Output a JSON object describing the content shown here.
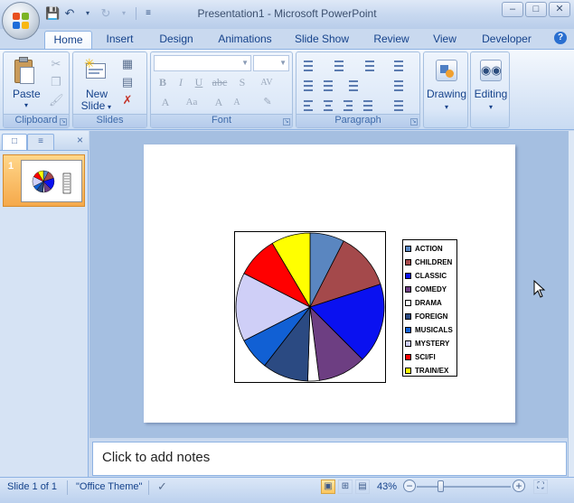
{
  "window": {
    "title": "Presentation1 - Microsoft PowerPoint",
    "controls": {
      "minimize": "–",
      "maximize": "□",
      "close": "✕"
    }
  },
  "qat": {
    "save_icon": "save-icon",
    "undo_icon": "undo-icon",
    "redo_icon": "redo-icon",
    "customize_icon": "customize-qat-icon"
  },
  "tabs": [
    {
      "label": "Home",
      "active": true
    },
    {
      "label": "Insert"
    },
    {
      "label": "Design"
    },
    {
      "label": "Animations"
    },
    {
      "label": "Slide Show"
    },
    {
      "label": "Review"
    },
    {
      "label": "View"
    },
    {
      "label": "Developer"
    }
  ],
  "ribbon": {
    "clipboard": {
      "label": "Clipboard",
      "paste": "Paste"
    },
    "slides": {
      "label": "Slides",
      "new_slide_line1": "New",
      "new_slide_line2": "Slide"
    },
    "font": {
      "label": "Font"
    },
    "paragraph": {
      "label": "Paragraph"
    },
    "drawing": {
      "label": "Drawing"
    },
    "editing": {
      "label": "Editing"
    }
  },
  "left_pane": {
    "slide_number": "1"
  },
  "chart_data": {
    "type": "pie",
    "categories": [
      "ACTION",
      "CHILDREN",
      "CLASSIC",
      "COMEDY",
      "DRAMA",
      "FOREIGN",
      "MUSICALS",
      "MYSTERY",
      "SCI/FI",
      "TRAIN/EX"
    ],
    "values": [
      7.5,
      12.5,
      17.5,
      10.5,
      2.5,
      10,
      7,
      15,
      9,
      8.5
    ],
    "colors": [
      "#5a86c0",
      "#a4494b",
      "#0a11f0",
      "#6d3e82",
      "#ffffff",
      "#2b4a82",
      "#1160d4",
      "#cfcff7",
      "#ff0000",
      "#ffff00"
    ]
  },
  "notes": {
    "placeholder": "Click to add notes"
  },
  "status": {
    "slide": "Slide 1 of 1",
    "theme": "\"Office Theme\"",
    "zoom": "43%",
    "zoom_level": 0.43
  }
}
